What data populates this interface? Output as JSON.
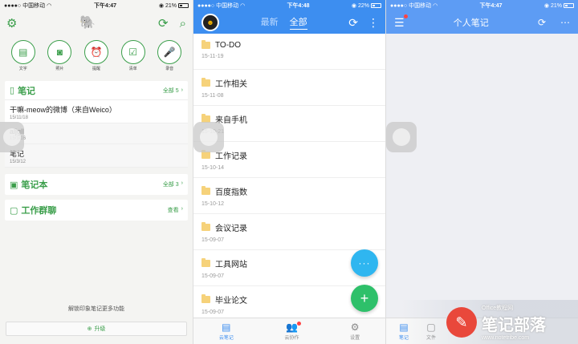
{
  "screen1": {
    "status": {
      "carrier": "中国移动",
      "time": "下午4:47",
      "battery": "21%"
    },
    "quick": [
      {
        "icon": "text-note-icon",
        "label": "文字"
      },
      {
        "icon": "camera-icon",
        "label": "照片"
      },
      {
        "icon": "reminder-icon",
        "label": "提醒"
      },
      {
        "icon": "checklist-icon",
        "label": "清单"
      },
      {
        "icon": "audio-icon",
        "label": "录音"
      }
    ],
    "notes_title": "笔记",
    "notes_all": "全部 5",
    "notes": [
      {
        "title": "干嘛-meow的微博（来自Weico）",
        "date": "15/11/18"
      },
      {
        "title": "aljgll",
        "date": "15/3/16"
      },
      {
        "title": "笔记",
        "date": "15/3/12"
      }
    ],
    "notebooks_title": "笔记本",
    "notebooks_all": "全部 3",
    "chat_title": "工作群聊",
    "chat_view": "查看",
    "tip": "解锁印象笔记更多功能",
    "upgrade": "升级"
  },
  "screen2": {
    "status": {
      "carrier": "中国移动",
      "time": "下午4:48",
      "battery": "22%"
    },
    "seg_recent": "最新",
    "seg_all": "全部",
    "folders": [
      {
        "name": "TO-DO",
        "date": "15-11-19"
      },
      {
        "name": "工作相关",
        "date": "15-11-08"
      },
      {
        "name": "来自手机",
        "date": "15-10-21"
      },
      {
        "name": "工作记录",
        "date": "15-10-14"
      },
      {
        "name": "百度指数",
        "date": "15-10-12"
      },
      {
        "name": "会议记录",
        "date": "15-09-07"
      },
      {
        "name": "工具网站",
        "date": "15-09-07"
      },
      {
        "name": "毕业论文",
        "date": "15-09-07"
      }
    ],
    "fab_more": "···",
    "fab_add": "+",
    "tabs": [
      {
        "label": "云笔记"
      },
      {
        "label": "云协作"
      },
      {
        "label": "设置"
      }
    ]
  },
  "screen3": {
    "status": {
      "carrier": "中国移动",
      "time": "下午4:47",
      "battery": "21%"
    },
    "title": "个人笔记",
    "tabs": [
      {
        "label": "笔记"
      },
      {
        "label": "文件"
      }
    ],
    "watermark": {
      "name": "笔记部落",
      "url": "www.notetribe.com",
      "brand": "Office教程网"
    }
  }
}
